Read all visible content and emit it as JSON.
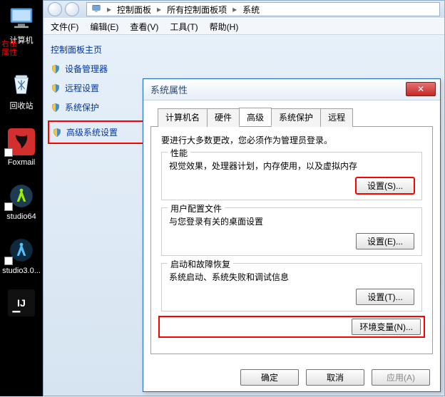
{
  "desktop": {
    "computer_label": "计算机",
    "annot_line1": "右击",
    "annot_line2": "属性",
    "recycle_label": "回收站",
    "foxmail_label": "Foxmail",
    "studio64_label": "studio64",
    "studio30_label": "studio3.0...",
    "ij_label": ""
  },
  "breadcrumb": {
    "root": "控制面板",
    "level2": "所有控制面板项",
    "level3": "系统"
  },
  "menubar": {
    "file": "文件(F)",
    "edit": "编辑(E)",
    "view": "查看(V)",
    "tools": "工具(T)",
    "help": "帮助(H)"
  },
  "sidebar": {
    "heading": "控制面板主页",
    "items": [
      {
        "label": "设备管理器"
      },
      {
        "label": "远程设置"
      },
      {
        "label": "系统保护"
      },
      {
        "label": "高级系统设置"
      }
    ]
  },
  "dialog": {
    "title": "系统属性",
    "tabs": {
      "t1": "计算机名",
      "t2": "硬件",
      "t3": "高级",
      "t4": "系统保护",
      "t5": "远程"
    },
    "admin_note": "要进行大多数更改，您必须作为管理员登录。",
    "perf": {
      "title": "性能",
      "desc": "视觉效果，处理器计划，内存使用，以及虚拟内存",
      "btn": "设置(S)..."
    },
    "profile": {
      "title": "用户配置文件",
      "desc": "与您登录有关的桌面设置",
      "btn": "设置(E)..."
    },
    "startup": {
      "title": "启动和故障恢复",
      "desc": "系统启动、系统失败和调试信息",
      "btn": "设置(T)..."
    },
    "env_btn": "环境变量(N)...",
    "ok": "确定",
    "cancel": "取消",
    "apply": "应用(A)"
  }
}
